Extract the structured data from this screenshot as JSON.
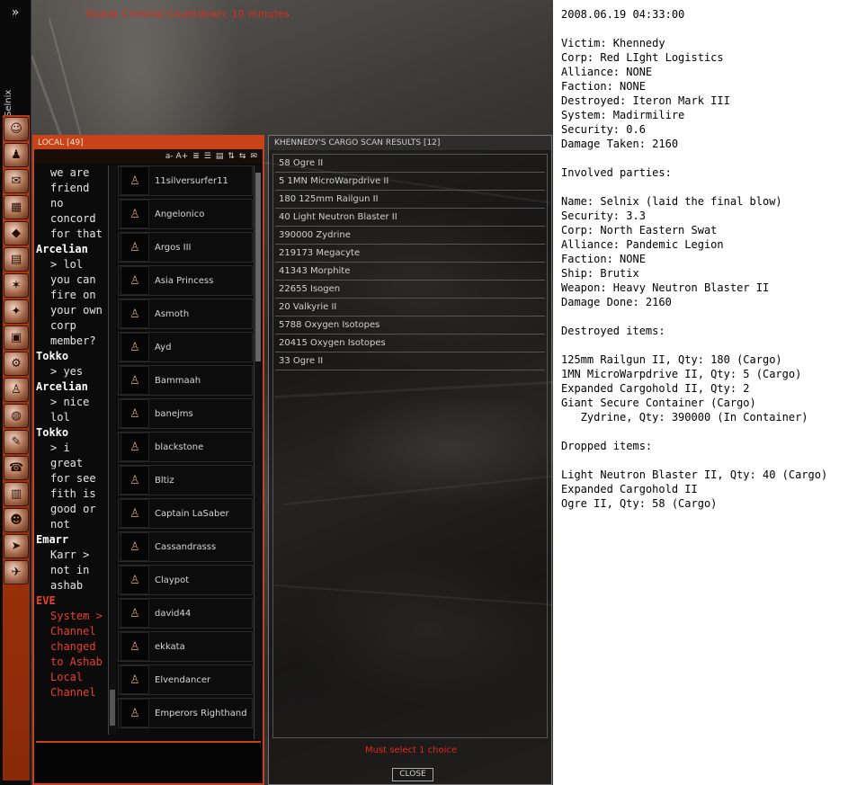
{
  "neocom": {
    "expand_label": "»",
    "pilot_name": "Selnix",
    "buttons": [
      {
        "icon": "character-sheet-icon",
        "glyph": "☺"
      },
      {
        "icon": "people-icon",
        "glyph": "♟"
      },
      {
        "icon": "mail-icon",
        "glyph": "✉"
      },
      {
        "icon": "assets-icon",
        "glyph": "▦"
      },
      {
        "icon": "wallet-icon",
        "glyph": "◆"
      },
      {
        "icon": "journal-icon",
        "glyph": "▤"
      },
      {
        "icon": "map-icon",
        "glyph": "✶"
      },
      {
        "icon": "corporation-icon",
        "glyph": "✦"
      },
      {
        "icon": "market-icon",
        "glyph": "▣"
      },
      {
        "icon": "science-icon",
        "glyph": "⚙"
      },
      {
        "icon": "fleet-icon",
        "glyph": "♙"
      },
      {
        "icon": "browser-icon",
        "glyph": "◍"
      },
      {
        "icon": "notepad-icon",
        "glyph": "✎"
      },
      {
        "icon": "help-icon",
        "glyph": "☎"
      },
      {
        "icon": "calculator-icon",
        "glyph": "▥"
      },
      {
        "icon": "aura-icon",
        "glyph": "☻"
      },
      {
        "icon": "ship-icon",
        "glyph": "➤"
      },
      {
        "icon": "drones-icon",
        "glyph": "✈"
      }
    ]
  },
  "viewport": {
    "countdown": "Global Criminal Countdown: 10 minutes"
  },
  "local": {
    "title": "LOCAL [49]",
    "tools": [
      "a- A+",
      "≣",
      "☰",
      "▤",
      "⇅",
      "⇆",
      "✉"
    ],
    "messages": [
      {
        "who": "",
        "text": "we are friend no concord for that",
        "system": false
      },
      {
        "who": "Arcelian",
        "text": "> lol you can fire on your own corp member?",
        "system": false
      },
      {
        "who": "Tokko",
        "text": "> yes",
        "system": false
      },
      {
        "who": "Arcelian",
        "text": "> nice lol",
        "system": false
      },
      {
        "who": "Tokko",
        "text": "> i great for see fith is good or not",
        "system": false
      },
      {
        "who": "Emarr",
        "text": "Karr > not in ashab",
        "system": false
      },
      {
        "who": "EVE",
        "text": "System > Channel changed to Ashab Local Channel",
        "system": true
      }
    ],
    "members": [
      "11silversurfer11",
      "Angelonico",
      "Argos III",
      "Asia Princess",
      "Asmoth",
      "Ayd",
      "Bammaah",
      "banejms",
      "blackstone",
      "Bltiz",
      "Captain LaSaber",
      "Cassandrasss",
      "Claypot",
      "david44",
      "ekkata",
      "Elvendancer",
      "Emperors Righthand"
    ]
  },
  "cargo": {
    "title": "KHENNEDY'S CARGO SCAN RESULTS [12]",
    "items": [
      "58 Ogre II",
      "5 1MN MicroWarpdrive II",
      "180 125mm Railgun II",
      "40 Light Neutron Blaster II",
      "390000 Zydrine",
      "219173 Megacyte",
      "41343 Morphite",
      "22655 Isogen",
      "20 Valkyrie II",
      "5788 Oxygen Isotopes",
      "20415 Oxygen Isotopes",
      "33 Ogre II"
    ],
    "status": "Must select 1 choice",
    "close_label": "CLOSE"
  },
  "killmail": {
    "lines": [
      "2008.06.19 04:33:00",
      "",
      "Victim: Khennedy",
      "Corp: Red LIght Logistics",
      "Alliance: NONE",
      "Faction: NONE",
      "Destroyed: Iteron Mark III",
      "System: Madirmilire",
      "Security: 0.6",
      "Damage Taken: 2160",
      "",
      "Involved parties:",
      "",
      "Name: Selnix (laid the final blow)",
      "Security: 3.3",
      "Corp: North Eastern Swat",
      "Alliance: Pandemic Legion",
      "Faction: NONE",
      "Ship: Brutix",
      "Weapon: Heavy Neutron Blaster II",
      "Damage Done: 2160",
      "",
      "Destroyed items:",
      "",
      "125mm Railgun II, Qty: 180 (Cargo)",
      "1MN MicroWarpdrive II, Qty: 5 (Cargo)",
      "Expanded Cargohold II, Qty: 2",
      "Giant Secure Container (Cargo)",
      "   Zydrine, Qty: 390000 (In Container)",
      "",
      "Dropped items:",
      "",
      "Light Neutron Blaster II, Qty: 40 (Cargo)",
      "Expanded Cargohold II",
      "Ogre II, Qty: 58 (Cargo)"
    ]
  }
}
